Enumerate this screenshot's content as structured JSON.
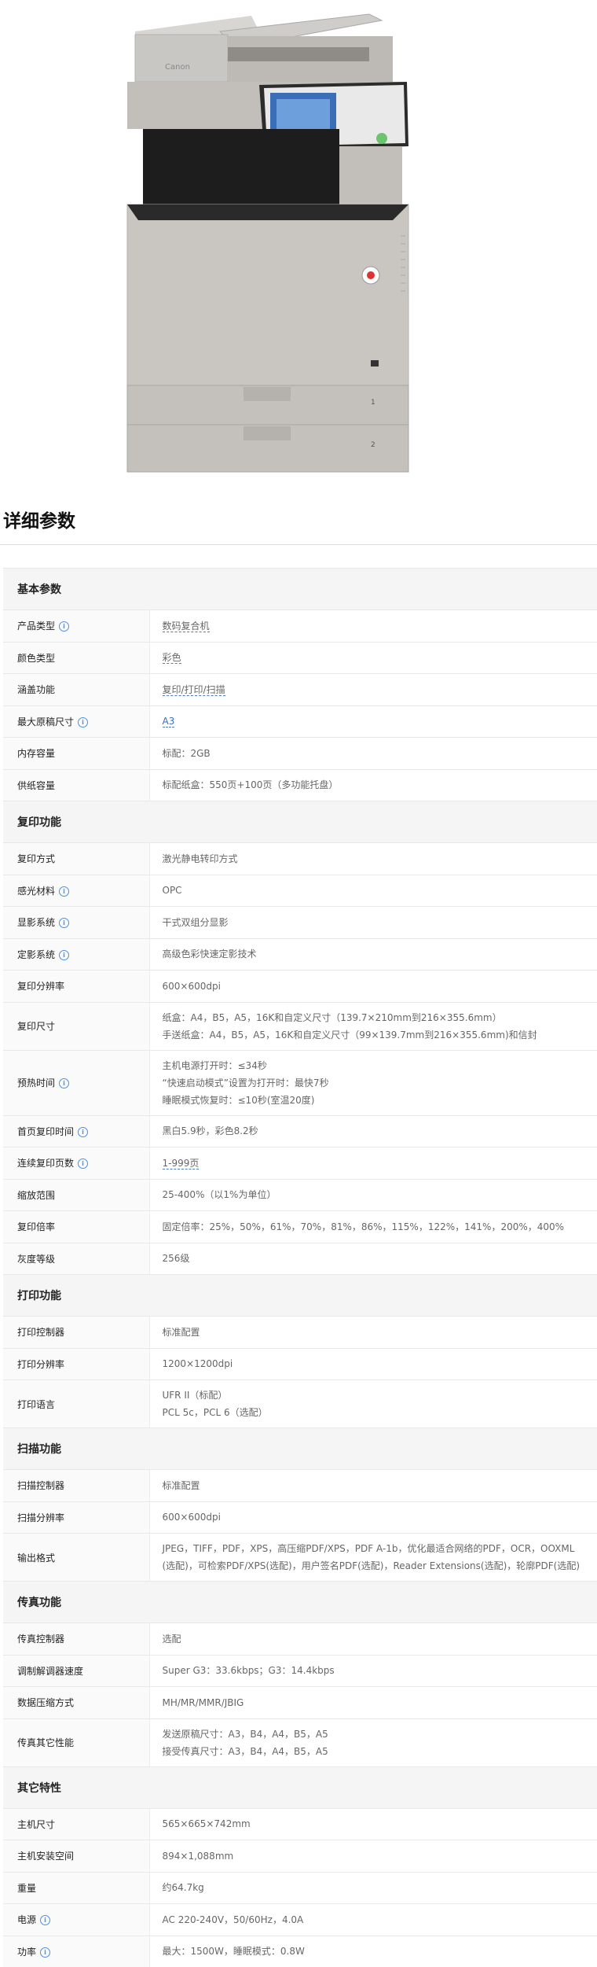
{
  "product_image": {
    "brand_label": "Canon",
    "tray_labels": [
      "1",
      "2"
    ]
  },
  "section_title": "详细参数",
  "groups": [
    {
      "title": "基本参数",
      "rows": [
        {
          "name": "产品类型",
          "info": true,
          "value": "数码复合机",
          "link": true
        },
        {
          "name": "颜色类型",
          "info": false,
          "value": "彩色",
          "link": true
        },
        {
          "name": "涵盖功能",
          "info": false,
          "value": "复印/打印/扫描",
          "link": true
        },
        {
          "name": "最大原稿尺寸",
          "info": true,
          "value": "A3",
          "link": true
        },
        {
          "name": "内存容量",
          "info": false,
          "value": "标配：2GB"
        },
        {
          "name": "供纸容量",
          "info": false,
          "value": "标配纸盒：550页+100页（多功能托盘）"
        }
      ]
    },
    {
      "title": "复印功能",
      "rows": [
        {
          "name": "复印方式",
          "info": false,
          "value": "激光静电转印方式"
        },
        {
          "name": "感光材料",
          "info": true,
          "value": "OPC"
        },
        {
          "name": "显影系统",
          "info": true,
          "value": "干式双组分显影"
        },
        {
          "name": "定影系统",
          "info": true,
          "value": "高级色彩快速定影技术"
        },
        {
          "name": "复印分辨率",
          "info": false,
          "value": "600×600dpi"
        },
        {
          "name": "复印尺寸",
          "info": false,
          "lines": [
            "纸盒：A4，B5，A5，16K和自定义尺寸（139.7×210mm到216×355.6mm）",
            "手送纸盒：A4，B5，A5，16K和自定义尺寸（99×139.7mm到216×355.6mm)和信封"
          ]
        },
        {
          "name": "预热时间",
          "info": true,
          "lines": [
            "主机电源打开时：≤34秒",
            "“快速启动模式”设置为打开时：最快7秒",
            "睡眠模式恢复时：≤10秒(室温20度)"
          ]
        },
        {
          "name": "首页复印时间",
          "info": true,
          "value": "黑白5.9秒，彩色8.2秒"
        },
        {
          "name": "连续复印页数",
          "info": true,
          "value": "1-999页",
          "link": true
        },
        {
          "name": "缩放范围",
          "info": false,
          "value": "25-400%（以1%为单位）"
        },
        {
          "name": "复印倍率",
          "info": false,
          "value": "固定倍率：25%，50%，61%，70%，81%，86%，115%，122%，141%，200%，400%"
        },
        {
          "name": "灰度等级",
          "info": false,
          "value": "256级"
        }
      ]
    },
    {
      "title": "打印功能",
      "rows": [
        {
          "name": "打印控制器",
          "info": false,
          "value": "标准配置"
        },
        {
          "name": "打印分辨率",
          "info": false,
          "value": "1200×1200dpi"
        },
        {
          "name": "打印语言",
          "info": false,
          "lines": [
            "UFR II（标配）",
            "PCL 5c，PCL 6（选配）"
          ]
        }
      ]
    },
    {
      "title": "扫描功能",
      "rows": [
        {
          "name": "扫描控制器",
          "info": false,
          "value": "标准配置"
        },
        {
          "name": "扫描分辨率",
          "info": false,
          "value": "600×600dpi"
        },
        {
          "name": "输出格式",
          "info": false,
          "lines": [
            "JPEG，TIFF，PDF，XPS，高压缩PDF/XPS，PDF A-1b，优化最适合网络的PDF，OCR，OOXML",
            "(选配)，可检索PDF/XPS(选配)，用户签名PDF(选配)，Reader Extensions(选配)，轮廓PDF(选配)"
          ]
        }
      ]
    },
    {
      "title": "传真功能",
      "rows": [
        {
          "name": "传真控制器",
          "info": false,
          "value": "选配"
        },
        {
          "name": "调制解调器速度",
          "info": false,
          "value": "Super G3：33.6kbps；G3：14.4kbps"
        },
        {
          "name": "数据压缩方式",
          "info": false,
          "value": "MH/MR/MMR/JBIG"
        },
        {
          "name": "传真其它性能",
          "info": false,
          "lines": [
            "发送原稿尺寸：A3，B4，A4，B5，A5",
            "接受传真尺寸：A3，B4，A4，B5，A5"
          ]
        }
      ]
    },
    {
      "title": "其它特性",
      "rows": [
        {
          "name": "主机尺寸",
          "info": false,
          "value": "565×665×742mm"
        },
        {
          "name": "主机安装空间",
          "info": false,
          "value": "894×1,088mm"
        },
        {
          "name": "重量",
          "info": false,
          "value": "约64.7kg"
        },
        {
          "name": "电源",
          "info": true,
          "value": "AC 220-240V，50/60Hz，4.0A"
        },
        {
          "name": "功率",
          "info": true,
          "value": "最大：1500W，睡眠模式：0.8W"
        }
      ]
    }
  ]
}
